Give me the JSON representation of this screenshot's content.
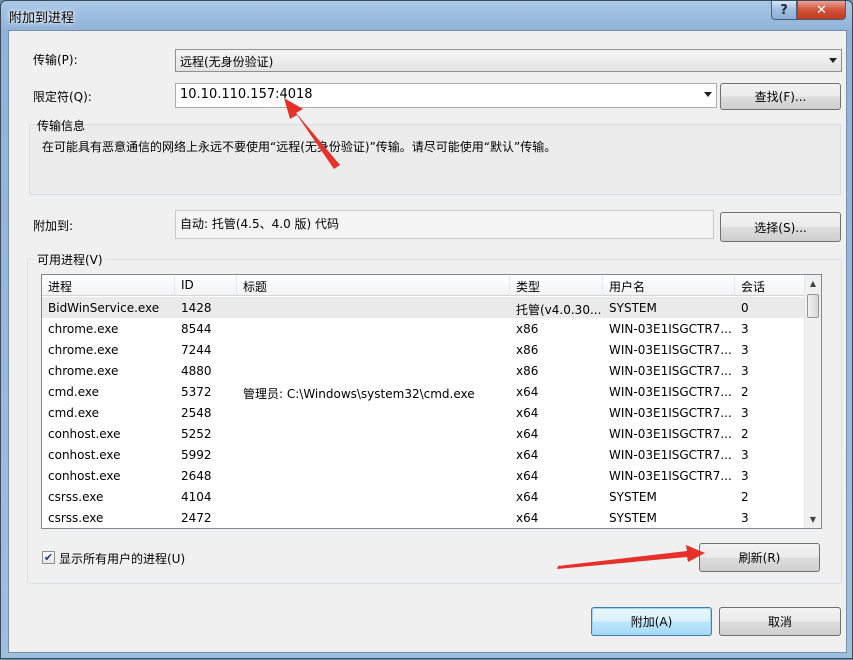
{
  "window": {
    "title": "附加到进程",
    "help_icon": "?",
    "close_icon": "✕"
  },
  "transport": {
    "label": "传输(P):",
    "value": "远程(无身份验证)"
  },
  "qualifier": {
    "label": "限定符(Q):",
    "value": "10.10.110.157:4018",
    "find_button": "查找(F)..."
  },
  "transport_info": {
    "title": "传输信息",
    "text": "在可能具有恶意通信的网络上永远不要使用“远程(无身份验证)”传输。请尽可能使用“默认”传输。"
  },
  "attach_to": {
    "label": "附加到:",
    "value": "自动: 托管(4.5、4.0 版) 代码",
    "select_button": "选择(S)..."
  },
  "processes": {
    "group_title": "可用进程(V)",
    "columns": [
      "进程",
      "ID",
      "标题",
      "类型",
      "用户名",
      "会话"
    ],
    "rows": [
      [
        "BidWinService.exe",
        "1428",
        "",
        "托管(v4.0.30...",
        "SYSTEM",
        "0"
      ],
      [
        "chrome.exe",
        "8544",
        "",
        "x86",
        "WIN-03E1ISGCTR7...",
        "3"
      ],
      [
        "chrome.exe",
        "7244",
        "",
        "x86",
        "WIN-03E1ISGCTR7...",
        "3"
      ],
      [
        "chrome.exe",
        "4880",
        "",
        "x86",
        "WIN-03E1ISGCTR7...",
        "3"
      ],
      [
        "cmd.exe",
        "5372",
        "管理员: C:\\Windows\\system32\\cmd.exe",
        "x64",
        "WIN-03E1ISGCTR7...",
        "2"
      ],
      [
        "cmd.exe",
        "2548",
        "",
        "x64",
        "WIN-03E1ISGCTR7...",
        "3"
      ],
      [
        "conhost.exe",
        "5252",
        "",
        "x64",
        "WIN-03E1ISGCTR7...",
        "2"
      ],
      [
        "conhost.exe",
        "5992",
        "",
        "x64",
        "WIN-03E1ISGCTR7...",
        "3"
      ],
      [
        "conhost.exe",
        "2648",
        "",
        "x64",
        "WIN-03E1ISGCTR7...",
        "3"
      ],
      [
        "csrss.exe",
        "4104",
        "",
        "x64",
        "SYSTEM",
        "2"
      ],
      [
        "csrss.exe",
        "2472",
        "",
        "x64",
        "SYSTEM",
        "3"
      ]
    ],
    "show_all_users": {
      "label": "显示所有用户的进程(U)",
      "checked": true,
      "check_glyph": "✔"
    },
    "refresh_button": "刷新(R)"
  },
  "footer": {
    "attach_button": "附加(A)",
    "cancel_button": "取消"
  },
  "scroll_glyphs": {
    "up": "▲",
    "down": "▼"
  }
}
